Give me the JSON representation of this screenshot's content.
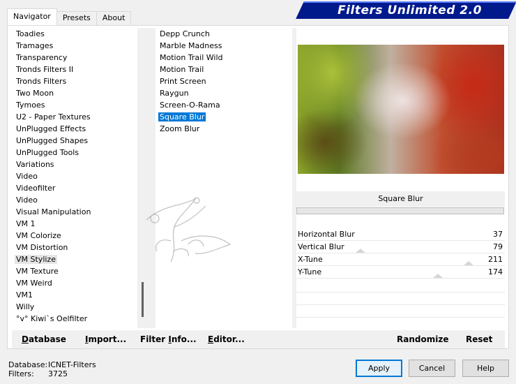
{
  "tabs": [
    {
      "label": "Navigator",
      "active": true
    },
    {
      "label": "Presets",
      "active": false
    },
    {
      "label": "About",
      "active": false
    }
  ],
  "app_title": "Filters Unlimited 2.0",
  "categories": [
    "Toadies",
    "Tramages",
    "Transparency",
    "Tronds Filters II",
    "Tronds Filters",
    "Two Moon",
    "Tymoes",
    "U2 - Paper Textures",
    "UnPlugged Effects",
    "UnPlugged Shapes",
    "UnPlugged Tools",
    "Variations",
    "Video",
    "Videofilter",
    "Video",
    "Visual Manipulation",
    "VM 1",
    "VM Colorize",
    "VM Distortion",
    "VM Stylize",
    "VM Texture",
    "VM Weird",
    "VM1",
    "Willy",
    "°v° Kiwi`s Oelfilter"
  ],
  "selected_category": "VM Stylize",
  "filters": [
    "Depp Crunch",
    "Marble Madness",
    "Motion Trail Wild",
    "Motion Trail",
    "Print Screen",
    "Raygun",
    "Screen-O-Rama",
    "Square Blur",
    "Zoom Blur"
  ],
  "selected_filter": "Square Blur",
  "filter_name_display": "Square Blur",
  "params": [
    {
      "label": "Horizontal Blur",
      "value": "37"
    },
    {
      "label": "Vertical Blur",
      "value": "79"
    },
    {
      "label": "X-Tune",
      "value": "211"
    },
    {
      "label": "Y-Tune",
      "value": "174"
    }
  ],
  "bottom_buttons": {
    "database": {
      "ul": "D",
      "rest": "atabase"
    },
    "import": {
      "ul": "I",
      "rest": "mport..."
    },
    "filter_info": {
      "pre": "Filter ",
      "ul": "I",
      "rest": "nfo..."
    },
    "editor": {
      "ul": "E",
      "rest": "ditor..."
    },
    "randomize": "Randomize",
    "reset": "Reset"
  },
  "status": {
    "database_label": "Database:",
    "database_value": "ICNET-Filters",
    "filters_label": "Filters:",
    "filters_value": "3725"
  },
  "dialog_buttons": {
    "apply": "Apply",
    "cancel": "Cancel",
    "help": "Help"
  },
  "colors": {
    "title_banner": "#001a8c",
    "selection": "#0078d7"
  }
}
